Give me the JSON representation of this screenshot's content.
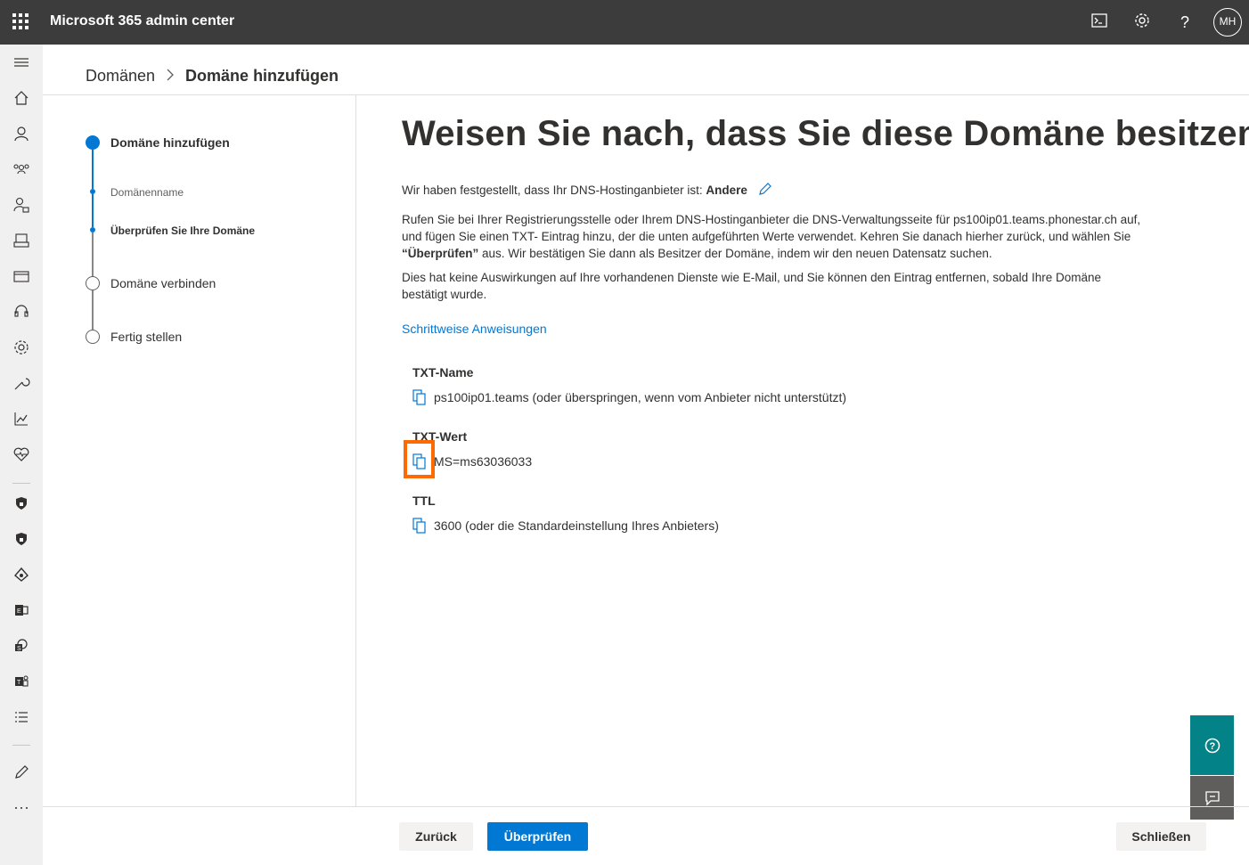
{
  "topbar": {
    "app_title": "Microsoft 365 admin center",
    "icons": [
      "app-launcher-icon",
      "terminal-icon",
      "gear-icon",
      "help-icon"
    ],
    "avatar_initials": "MH"
  },
  "leftnav": {
    "icons": [
      "hamburger-icon",
      "home-icon",
      "user-icon",
      "teams-group-icon",
      "user-lock-icon",
      "devices-icon",
      "billing-icon",
      "support-icon",
      "settings-icon",
      "setup-icon",
      "reports-icon",
      "health-icon",
      "security-icon",
      "compliance-icon",
      "azure-ad-icon",
      "exchange-icon",
      "sharepoint-icon",
      "teams-icon",
      "all-admin-centers-icon",
      "customize-icon",
      "more-icon"
    ]
  },
  "breadcrumb": {
    "parent": "Domänen",
    "separator": ">",
    "current": "Domäne hinzufügen"
  },
  "stepper": {
    "steps": [
      {
        "label": "Domäne hinzufügen",
        "state": "active"
      },
      {
        "label": "Domänenname",
        "state": "substep-done"
      },
      {
        "label": "Überprüfen Sie Ihre Domäne",
        "state": "substep-active"
      },
      {
        "label": "Domäne verbinden",
        "state": "pending"
      },
      {
        "label": "Fertig stellen",
        "state": "pending"
      }
    ]
  },
  "main": {
    "title": "Weisen Sie nach, dass Sie diese Domäne besitzen",
    "detected_prefix": "Wir haben festgestellt, dass Ihr DNS-Hostinganbieter ist: ",
    "detected_provider": "Andere",
    "instructions_part1": "Rufen Sie bei Ihrer Registrierungsstelle oder Ihrem DNS-Hostinganbieter die DNS-Verwaltungsseite für ps100ip01.teams.phonestar.ch auf, und fügen Sie einen TXT- Eintrag hinzu, der die unten aufgeführten Werte verwendet. Kehren Sie danach hierher zurück, und wählen Sie ",
    "instructions_bold": "“Überprüfen”",
    "instructions_part2": " aus. Wir bestätigen Sie dann als Besitzer der Domäne, indem wir den neuen Datensatz suchen.",
    "note": "Dies hat keine Auswirkungen auf Ihre vorhandenen Dienste wie E-Mail, und Sie können den Eintrag entfernen, sobald Ihre Domäne bestätigt wurde.",
    "link": "Schrittweise Anweisungen",
    "fields": [
      {
        "label": "TXT-Name",
        "value": "ps100ip01.teams (oder überspringen, wenn vom Anbieter nicht unterstützt)"
      },
      {
        "label": "TXT-Wert",
        "value": "MS=ms63036033"
      },
      {
        "label": "TTL",
        "value": "3600 (oder die Standardeinstellung Ihres Anbieters)"
      }
    ]
  },
  "footer": {
    "back": "Zurück",
    "verify": "Überprüfen",
    "close": "Schließen"
  },
  "colors": {
    "topbar": "#3c3c3c",
    "accent": "#0078d4",
    "highlight": "#ff6a00",
    "help_fab": "#038387",
    "feedback_fab": "#605e5c"
  }
}
